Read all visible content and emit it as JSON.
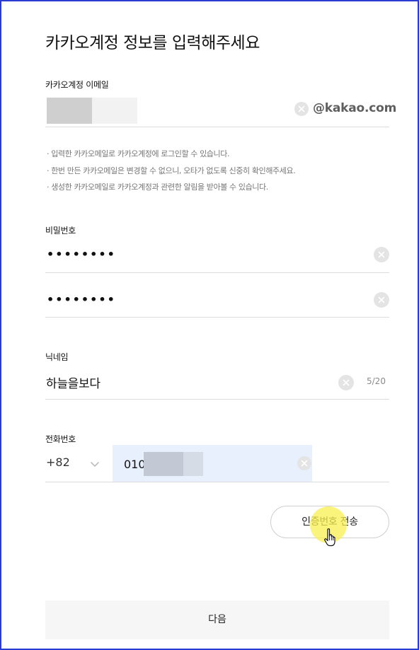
{
  "page": {
    "title": "카카오계정 정보를 입력해주세요"
  },
  "email": {
    "label": "카카오계정 이메일",
    "domain": "@kakao.com",
    "notes": [
      "· 입력한 카카오메일로 카카오계정에 로그인할 수 있습니다.",
      "· 한번 만든 카카오메일은 변경할 수 없으니, 오타가 없도록 신중히 확인해주세요.",
      "· 생성한 카카오메일로 카카오계정과 관련한 알림을 받아볼 수 있습니다."
    ]
  },
  "password": {
    "label": "비밀번호",
    "value_masked": "••••••••",
    "confirm_masked": "••••••••"
  },
  "nickname": {
    "label": "닉네임",
    "value": "하늘을보다",
    "counter": "5/20"
  },
  "phone": {
    "label": "전화번호",
    "country_code": "+82",
    "value_prefix": "010"
  },
  "buttons": {
    "send_code": "인증번호 전송",
    "next": "다음"
  },
  "colors": {
    "frame_border": "#2a3bd1",
    "autofill_bg": "#e8f0fe",
    "clear_btn": "#e4e4e4",
    "highlight": "#faf050"
  },
  "icons": {
    "clear": "close-circle-icon",
    "country_dropdown": "chevron-down-icon",
    "pointer": "hand-pointer-icon"
  }
}
